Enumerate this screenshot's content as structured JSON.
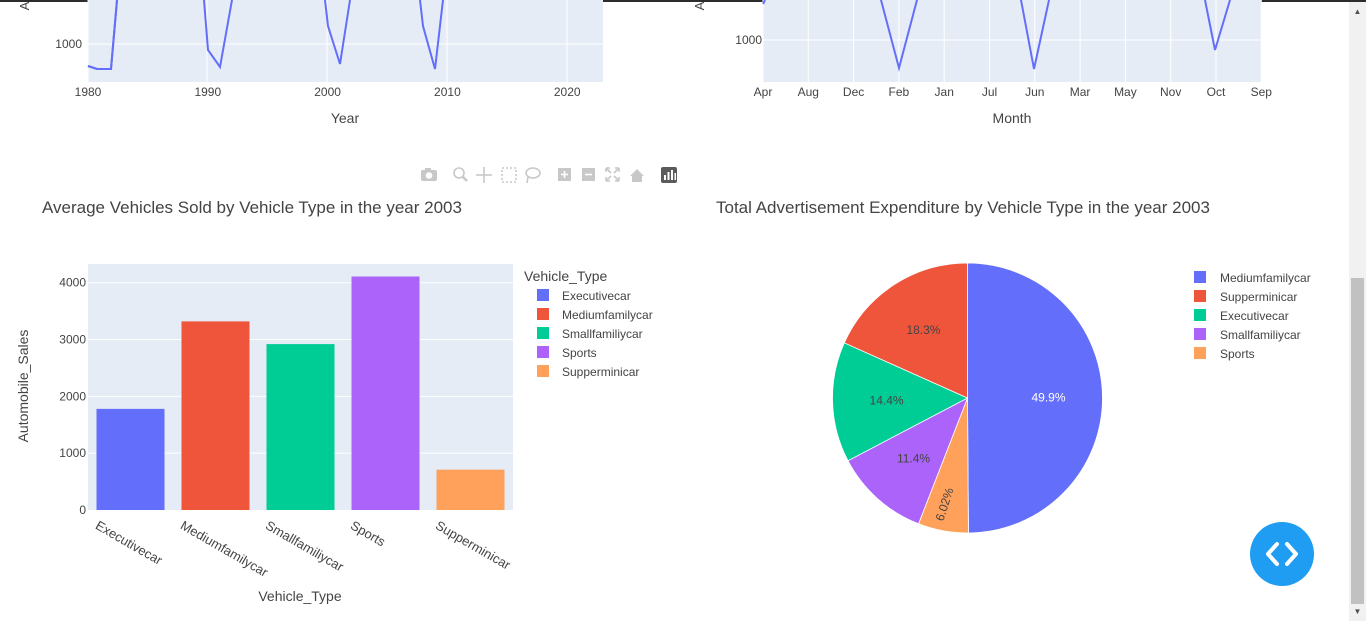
{
  "top_charts": [
    {
      "xlabel": "Year",
      "ytick": "1000",
      "xticks": [
        "1980",
        "1990",
        "2000",
        "2010",
        "2020"
      ],
      "yaxis_fragment": "A"
    },
    {
      "xlabel": "Month",
      "ytick": "1000",
      "xticks": [
        "Apr",
        "Aug",
        "Dec",
        "Feb",
        "Jan",
        "Jul",
        "Jun",
        "Mar",
        "May",
        "Nov",
        "Oct",
        "Sep"
      ],
      "yaxis_fragment": "A"
    }
  ],
  "chart_data": [
    {
      "type": "bar",
      "title": "Average Vehicles Sold by Vehicle Type in the year 2003",
      "xlabel": "Vehicle_Type",
      "ylabel": "Automobile_Sales",
      "categories": [
        "Executivecar",
        "Mediumfamilycar",
        "Smallfamiliycar",
        "Sports",
        "Supperminicar"
      ],
      "values": [
        1780,
        3320,
        2920,
        4110,
        710
      ],
      "colors": [
        "#636efa",
        "#ef553b",
        "#00cc96",
        "#ab63fa",
        "#ffa15a"
      ],
      "yticks": [
        "0",
        "1000",
        "2000",
        "3000",
        "4000"
      ],
      "ylim": [
        0,
        4330
      ],
      "legend": {
        "title": "Vehicle_Type",
        "entries": [
          "Executivecar",
          "Mediumfamilycar",
          "Smallfamiliycar",
          "Sports",
          "Supperminicar"
        ],
        "colors": [
          "#636efa",
          "#ef553b",
          "#00cc96",
          "#ab63fa",
          "#ffa15a"
        ]
      }
    },
    {
      "type": "pie",
      "title": "Total Advertisement Expenditure by Vehicle Type in the year 2003",
      "slices": [
        {
          "label": "Mediumfamilycar",
          "value": 49.9,
          "text": "49.9%",
          "color": "#636efa"
        },
        {
          "label": "Sports",
          "value": 6.02,
          "text": "6.02%",
          "color": "#ffa15a"
        },
        {
          "label": "Smallfamiliycar",
          "value": 11.4,
          "text": "11.4%",
          "color": "#ab63fa"
        },
        {
          "label": "Executivecar",
          "value": 14.4,
          "text": "14.4%",
          "color": "#00cc96"
        },
        {
          "label": "Supperminicar",
          "value": 18.3,
          "text": "18.3%",
          "color": "#ef553b"
        }
      ],
      "legend": {
        "entries": [
          "Mediumfamilycar",
          "Supperminicar",
          "Executivecar",
          "Smallfamiliycar",
          "Sports"
        ],
        "colors": [
          "#636efa",
          "#ef553b",
          "#00cc96",
          "#ab63fa",
          "#ffa15a"
        ]
      }
    }
  ],
  "modebar": {
    "icons": [
      "camera-icon",
      "zoom-icon",
      "pan-icon",
      "box-select-icon",
      "lasso-icon",
      "zoom-in-icon",
      "zoom-out-icon",
      "autoscale-icon",
      "home-icon",
      "plotly-logo-icon"
    ]
  },
  "fab": {
    "icon": "code-icon"
  }
}
